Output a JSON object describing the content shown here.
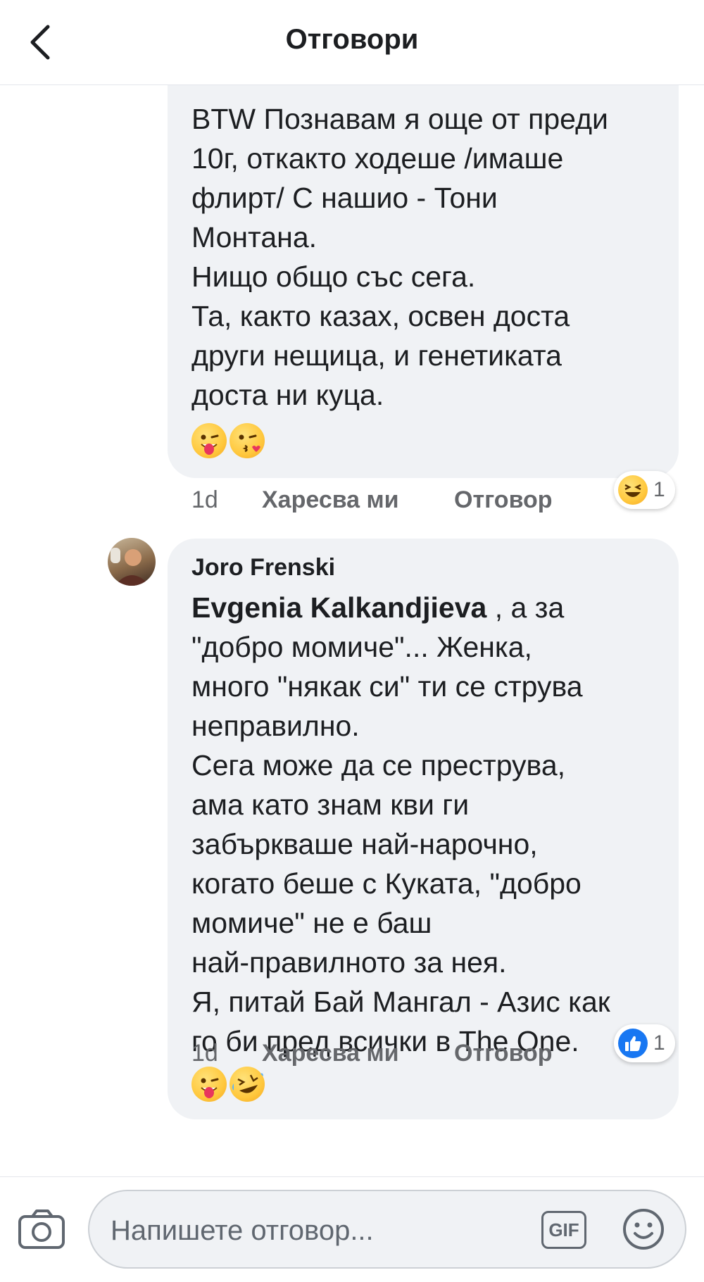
{
  "header": {
    "title": "Отговори"
  },
  "comments": [
    {
      "lines": [
        "BTW Познавам я още от преди",
        "10г, откакто ходеше /имаше",
        "флирт/ С нашио - Тони",
        "Монтана.",
        "Нищо общо със сега.",
        "Та, както казах, освен доста",
        "други нещица, и генетиката",
        "доста ни куца."
      ],
      "emojis": [
        "tongue-wink-emoji",
        "kiss-emoji"
      ],
      "time": "1d",
      "like_label": "Харесва ми",
      "reply_label": "Отговор",
      "reaction": {
        "icon": "haha-reaction-icon",
        "count": "1"
      }
    },
    {
      "author": "Joro Frenski",
      "mention": "Evgenia Kalkandjieva",
      "first_line_rest": " , а за",
      "lines": [
        "\"добро момиче\"... Женка,",
        "много \"някак си\" ти се струва",
        "неправилно.",
        "Сега може да се преструва,",
        "ама като знам кви ги",
        "забърква­ше най-нарочно,",
        "когато беше с Куката,  \"добро",
        "момиче\" не е баш",
        "най-правилното за нея.",
        "Я, питай Бай Мангал - Азис как",
        "го би пред всички в The One."
      ],
      "emojis": [
        "tongue-wink-emoji",
        "rofl-emoji"
      ],
      "time": "1d",
      "like_label": "Харесва ми",
      "reply_label": "Отговор",
      "reaction": {
        "icon": "like-reaction-icon",
        "count": "1"
      }
    }
  ],
  "composer": {
    "placeholder": "Напишете отговор...",
    "gif_label": "GIF"
  },
  "colors": {
    "link_blue": "#1877f2",
    "bubble": "#f0f2f5",
    "meta_gray": "#65676b"
  }
}
